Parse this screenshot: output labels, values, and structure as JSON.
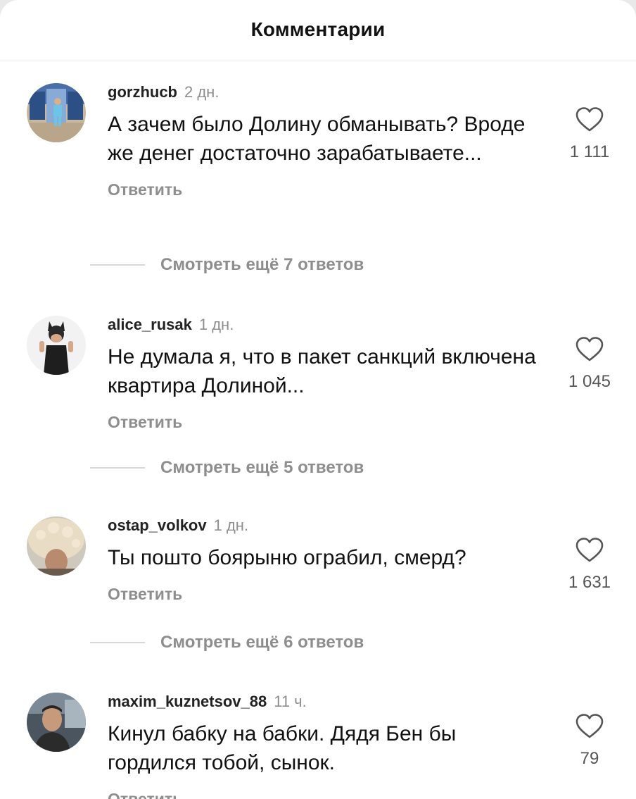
{
  "header": {
    "title": "Комментарии"
  },
  "comments": [
    {
      "username": "gorzhucb",
      "time": "2 дн.",
      "text": "А зачем было Долину обманывать? Вроде же денег достаточно зарабатываете...",
      "likes": "1 111",
      "reply": "Ответить",
      "more": "Смотреть ещё 7 ответов",
      "avatar_icon": "avatar-photo"
    },
    {
      "username": "alice_rusak",
      "time": "1 дн.",
      "text": "Не думала я, что в пакет санкций включена квартира Долиной...",
      "likes": "1 045",
      "reply": "Ответить",
      "more": "Смотреть ещё 5 ответов",
      "avatar_icon": "avatar-photo"
    },
    {
      "username": "ostap_volkov",
      "time": "1 дн.",
      "text": "Ты пошто боярыню ограбил, смерд?",
      "likes": "1 631",
      "reply": "Ответить",
      "more": "Смотреть ещё 6 ответов",
      "avatar_icon": "avatar-photo"
    },
    {
      "username": "maxim_kuznetsov_88",
      "time": "11 ч.",
      "text": "Кинул бабку на бабки. Дядя Бен бы гордился тобой, сынок.",
      "likes": "79",
      "reply": "Ответить",
      "avatar_icon": "avatar-photo"
    }
  ],
  "icons": {
    "like": "heart-outline-icon"
  },
  "colors": {
    "muted": "#8e8e8e",
    "text": "#111111",
    "background": "#ffffff"
  }
}
